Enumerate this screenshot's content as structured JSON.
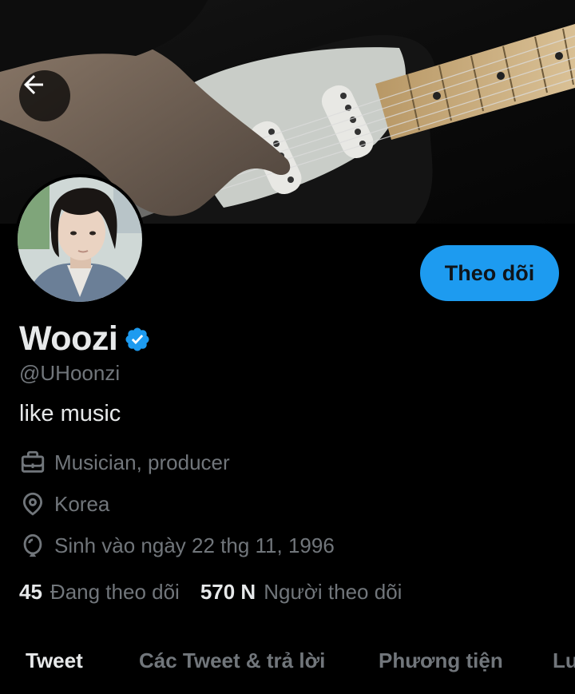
{
  "header": {
    "back_icon": "arrow-left-icon"
  },
  "profile": {
    "display_name": "Woozi",
    "verified_icon": "verified-badge-icon",
    "handle": "@UHoonzi",
    "bio": "like music",
    "job": "Musician, producer",
    "location": "Korea",
    "birthday": "Sinh vào ngày 22 thg 11, 1996",
    "follow_button": "Theo dõi"
  },
  "stats": {
    "following_count": "45",
    "following_label": "Đang theo dõi",
    "followers_count": "570 N",
    "followers_label": "Người theo dõi"
  },
  "tabs": [
    {
      "label": "Tweet",
      "active": true
    },
    {
      "label": "Các Tweet & trả lời",
      "active": false
    },
    {
      "label": "Phương tiện",
      "active": false
    },
    {
      "label": "Lượt thích",
      "active": false
    }
  ],
  "colors": {
    "accent": "#1d9bf0",
    "background": "#000000",
    "text_primary": "#e7e9ea",
    "text_secondary": "#71767b"
  }
}
